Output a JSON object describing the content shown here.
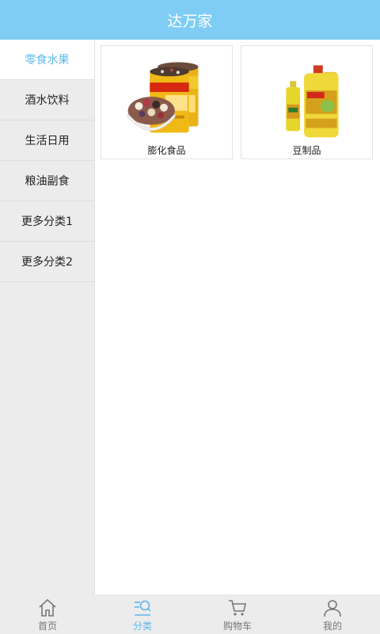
{
  "header": {
    "title": "达万家"
  },
  "sidebar": {
    "items": [
      {
        "label": "零食水果",
        "active": true
      },
      {
        "label": "酒水饮料",
        "active": false
      },
      {
        "label": "生活日用",
        "active": false
      },
      {
        "label": "粮油副食",
        "active": false
      },
      {
        "label": "更多分类1",
        "active": false
      },
      {
        "label": "更多分类2",
        "active": false
      }
    ]
  },
  "products": [
    {
      "label": "膨化食品",
      "image": "canned-grain-snack"
    },
    {
      "label": "豆制品",
      "image": "cooking-oil-bottles"
    }
  ],
  "tabbar": {
    "tabs": [
      {
        "label": "首页",
        "icon": "home-icon",
        "active": false
      },
      {
        "label": "分类",
        "icon": "category-search-icon",
        "active": true
      },
      {
        "label": "购物车",
        "icon": "cart-icon",
        "active": false
      },
      {
        "label": "我的",
        "icon": "user-icon",
        "active": false
      }
    ]
  },
  "colors": {
    "accent": "#7fcdf4",
    "active_text": "#5ab8ec"
  }
}
